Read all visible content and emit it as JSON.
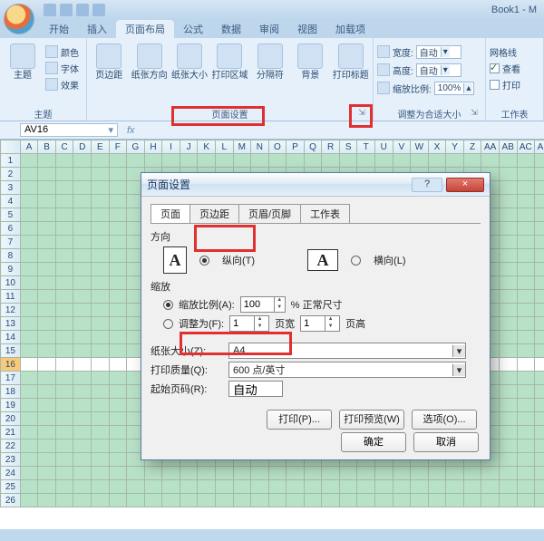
{
  "title": "Book1 - M",
  "tabs": [
    "开始",
    "插入",
    "页面布局",
    "公式",
    "数据",
    "审阅",
    "视图",
    "加载项"
  ],
  "active_tab_index": 2,
  "ribbon": {
    "themes": {
      "label": "主题",
      "main": "主题",
      "items": [
        "颜色",
        "字体",
        "效果"
      ]
    },
    "page_setup": {
      "label": "页面设置",
      "buttons": [
        "页边距",
        "纸张方向",
        "纸张大小",
        "打印区域",
        "分隔符",
        "背景",
        "打印标题"
      ]
    },
    "scale": {
      "label": "调整为合适大小",
      "width_label": "宽度:",
      "width_value": "自动",
      "height_label": "高度:",
      "height_value": "自动",
      "scale_label": "缩放比例:",
      "scale_value": "100%"
    },
    "sheet_options": {
      "label": "工作表",
      "gridlines": "网格线",
      "view": "查看",
      "print": "打印"
    }
  },
  "namebox": "AV16",
  "fx": "fx",
  "columns": [
    "A",
    "B",
    "C",
    "D",
    "E",
    "F",
    "G",
    "H",
    "I",
    "J",
    "K",
    "L",
    "M",
    "N",
    "O",
    "P",
    "Q",
    "R",
    "S",
    "T",
    "U",
    "V",
    "W",
    "X",
    "Y",
    "Z",
    "AA",
    "AB",
    "AC",
    "AD"
  ],
  "rows": [
    1,
    2,
    3,
    4,
    5,
    6,
    7,
    8,
    9,
    10,
    11,
    12,
    13,
    14,
    15,
    16,
    17,
    18,
    19,
    20,
    21,
    22,
    23,
    24,
    25,
    26
  ],
  "selected_row": 16,
  "dialog": {
    "title": "页面设置",
    "help": "?",
    "close": "×",
    "tabs": [
      "页面",
      "页边距",
      "页眉/页脚",
      "工作表"
    ],
    "active_tab": 0,
    "orientation": {
      "label": "方向",
      "portrait": "纵向(T)",
      "landscape": "横向(L)",
      "selected": "portrait"
    },
    "scaling": {
      "label": "缩放",
      "adjust_label": "缩放比例(A):",
      "adjust_value": "100",
      "adjust_suffix": "% 正常尺寸",
      "fit_label": "调整为(F):",
      "fit_wide": "1",
      "fit_wide_suffix": "页宽",
      "fit_tall": "1",
      "fit_tall_suffix": "页高",
      "selected": "adjust"
    },
    "paper_size_label": "纸张大小(Z):",
    "paper_size_value": "A4",
    "print_quality_label": "打印质量(Q):",
    "print_quality_value": "600 点/英寸",
    "first_page_label": "起始页码(R):",
    "first_page_value": "自动",
    "buttons": {
      "print": "打印(P)...",
      "preview": "打印预览(W)",
      "options": "选项(O)...",
      "ok": "确定",
      "cancel": "取消"
    }
  },
  "glyph_A": "A"
}
